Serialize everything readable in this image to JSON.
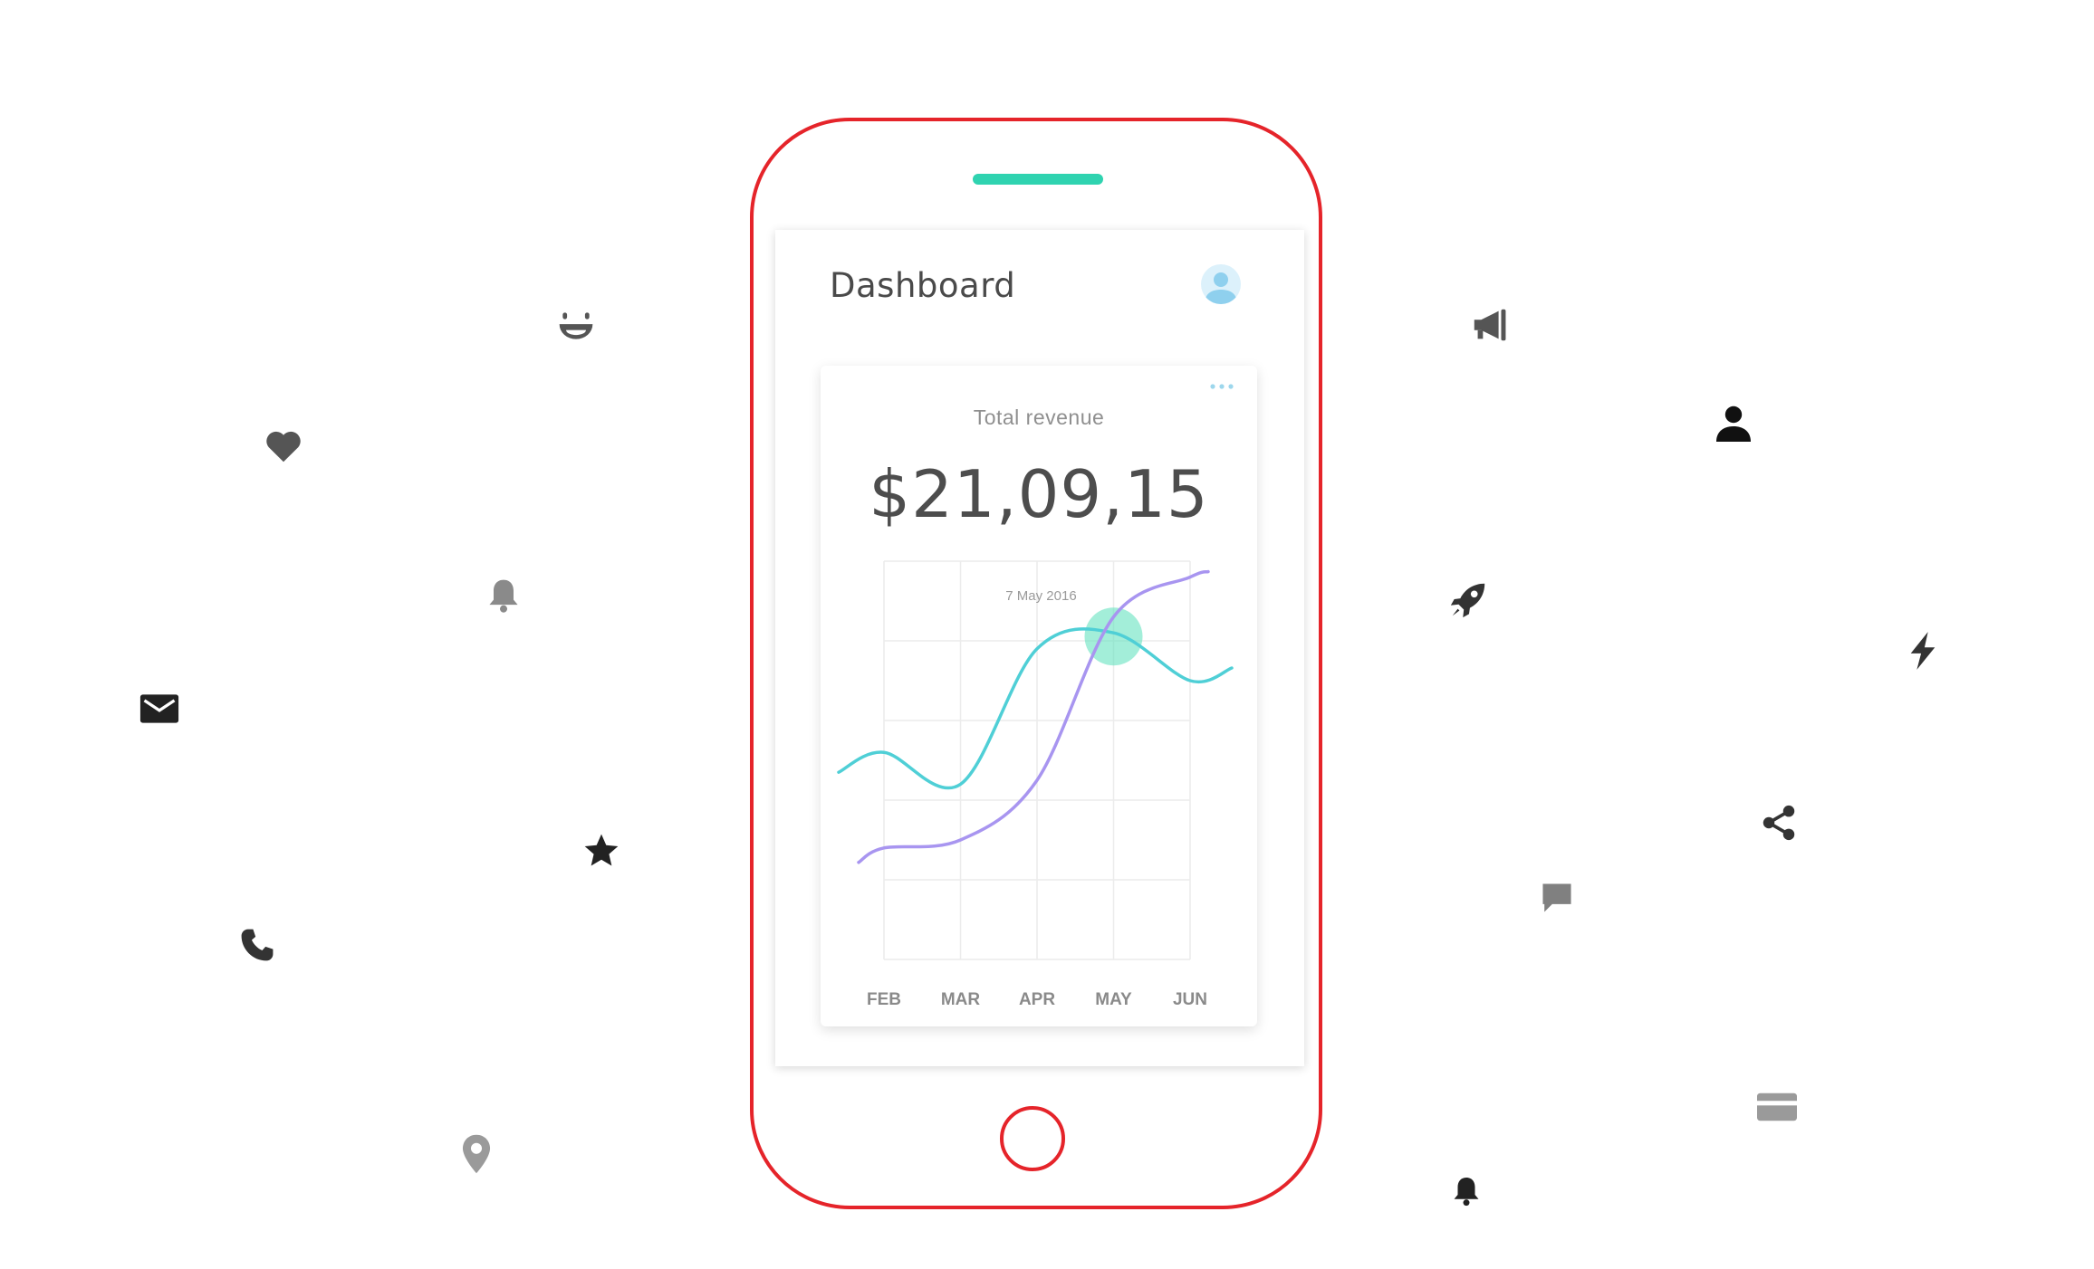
{
  "screen": {
    "title": "Dashboard",
    "avatar_icon": "user-avatar-icon"
  },
  "revenue_card": {
    "menu_icon": "more-dots-icon",
    "label": "Total revenue",
    "value": "$21,09,15",
    "tooltip_date": "7 May 2016"
  },
  "colors": {
    "phone_outline": "#e5242a",
    "speaker": "#2fd3b0",
    "series_teal": "#4fcfd6",
    "series_purple": "#a895f0",
    "highlight": "#66e3bf"
  },
  "floating_icons": [
    "smile-icon",
    "heart-icon",
    "bell-icon",
    "mail-icon",
    "star-icon",
    "phone-icon",
    "location-pin-icon",
    "megaphone-icon",
    "person-icon",
    "rocket-icon",
    "lightning-icon",
    "share-icon",
    "chat-icon",
    "credit-card-icon",
    "bell-icon"
  ],
  "chart_data": {
    "type": "line",
    "categories": [
      "FEB",
      "MAR",
      "APR",
      "MAY",
      "JUN"
    ],
    "series": [
      {
        "values": [
          0.52,
          0.44,
          0.78,
          0.82,
          0.7
        ]
      },
      {
        "values": [
          0.28,
          0.3,
          0.45,
          0.86,
          0.96
        ]
      }
    ],
    "highlight_category": "MAY",
    "grid": true
  }
}
